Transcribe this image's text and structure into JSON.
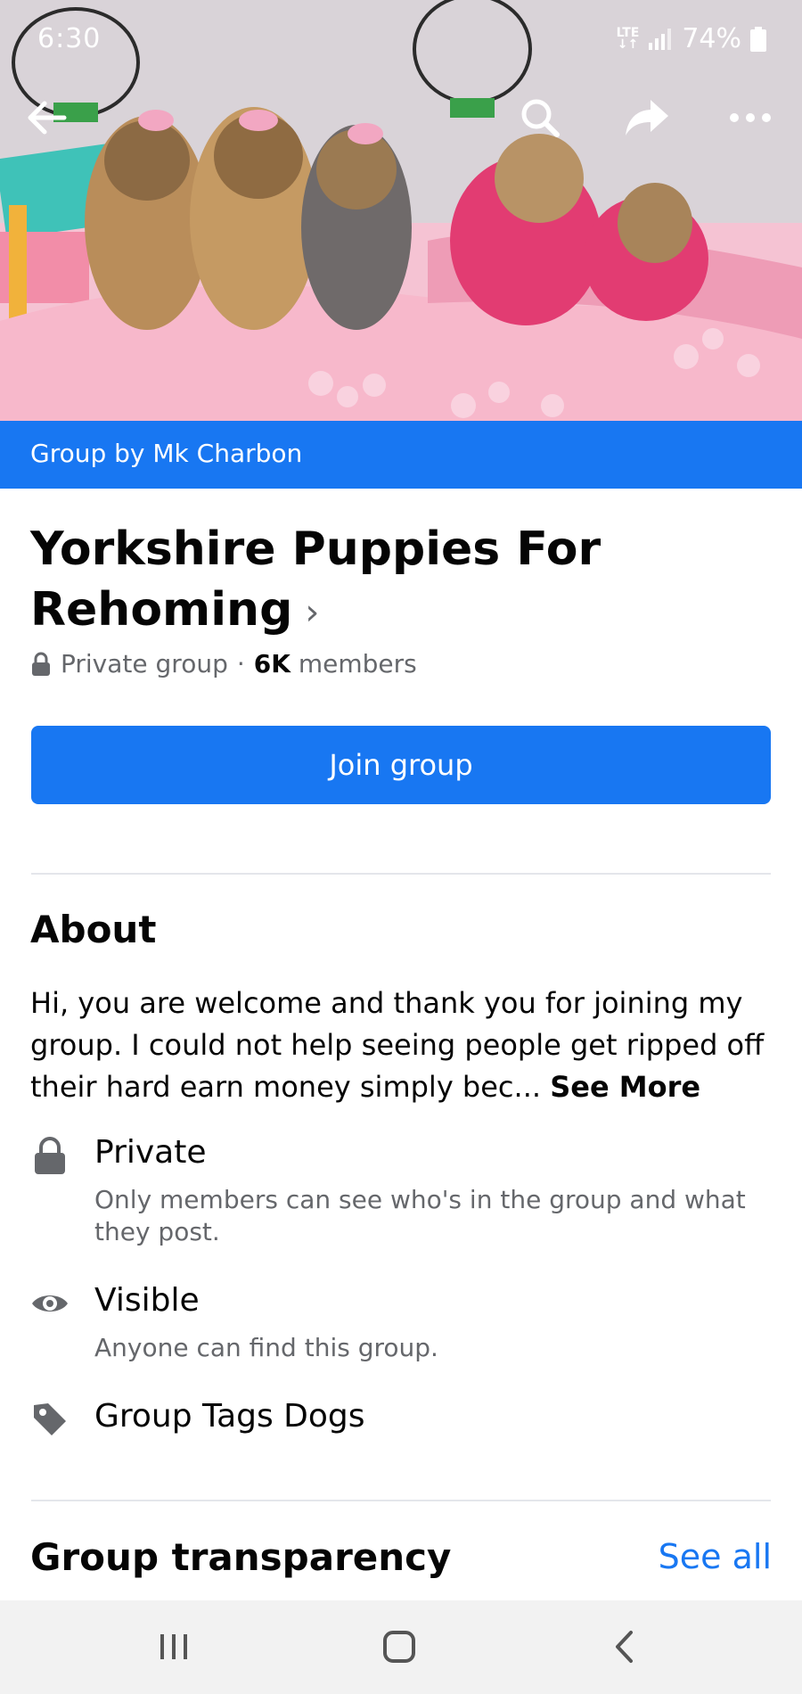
{
  "status_bar": {
    "time": "6:30",
    "network": "LTE",
    "battery": "74%"
  },
  "cover": {
    "image": "yorkshire-terrier-puppies-photo",
    "group_by": "Group by Mk Charbon"
  },
  "header": {
    "title": "Yorkshire Puppies For Rehoming",
    "chevron": "›",
    "privacy": "Private group",
    "separator": "·",
    "member_count": "6K",
    "members_label": "members"
  },
  "join_button": {
    "label": "Join group"
  },
  "about": {
    "heading": "About",
    "text": "Hi, you are welcome and thank you for joining my group. I could not help seeing people get ripped off their hard earn money simply bec...",
    "see_more": "See More",
    "items": [
      {
        "icon": "lock-icon",
        "title": "Private",
        "subtitle": "Only members can see who's in the group and what they post."
      },
      {
        "icon": "eye-icon",
        "title": "Visible",
        "subtitle": "Anyone can find this group."
      },
      {
        "icon": "tag-icon",
        "title": "Group Tags Dogs",
        "subtitle": ""
      }
    ]
  },
  "transparency": {
    "heading": "Group transparency",
    "see_all": "See all"
  },
  "colors": {
    "brand_blue": "#1877f2",
    "secondary_text": "#65676b",
    "primary_text": "#050505"
  }
}
